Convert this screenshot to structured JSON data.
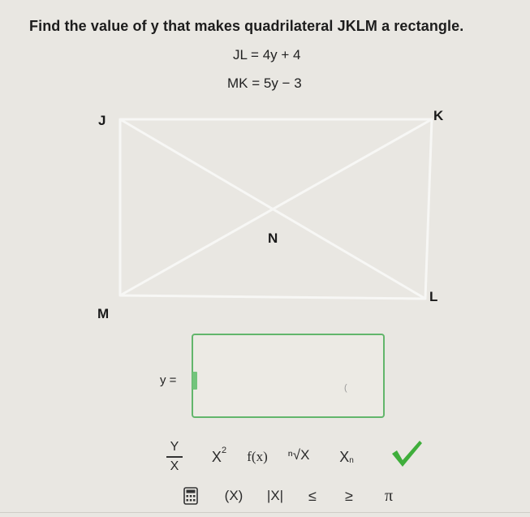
{
  "question": {
    "text": "Find the value of y that makes quadrilateral JKLM a rectangle.",
    "eq1": "JL = 4y + 4",
    "eq2": "MK = 5y − 3"
  },
  "diagram": {
    "vertices": {
      "J": "J",
      "K": "K",
      "L": "L",
      "M": "M",
      "N": "N"
    }
  },
  "answer": {
    "label": "y =",
    "value": "",
    "mark": "("
  },
  "toolbar": {
    "frac_num": "Y",
    "frac_den": "X",
    "square_base": "X",
    "square_exp": "2",
    "function": "f(x)",
    "root": "ⁿ√X",
    "subscript_base": "X",
    "subscript_sub": "n",
    "paren": "(X)",
    "abs": "|X|",
    "leq": "≤",
    "geq": "≥",
    "pi": "π"
  },
  "colors": {
    "accent_green": "#62b66b",
    "check_green": "#3fae3b"
  }
}
